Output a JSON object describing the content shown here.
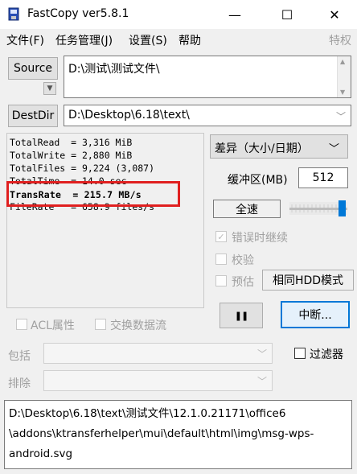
{
  "window": {
    "title": "FastCopy ver5.8.1",
    "controls": {
      "minimize": "—",
      "maximize": "☐",
      "close": "✕"
    }
  },
  "menu": {
    "items": [
      "文件(F)",
      "任务管理(J)",
      "设置(S)",
      "帮助"
    ],
    "right": "特权"
  },
  "source": {
    "button": "Source",
    "path": "D:\\测试\\测试文件\\"
  },
  "destdir": {
    "button": "DestDir",
    "path": "D:\\Desktop\\6.18\\text\\"
  },
  "stats": {
    "lines": [
      "TotalRead  = 3,316 MiB",
      "TotalWrite = 2,880 MiB",
      "TotalFiles = 9,224 (3,087)",
      "TotalTime  = 14.0 sec",
      "TransRate  = 215.7 MB/s",
      "FileRate   = 658.9 files/s"
    ]
  },
  "mode": {
    "selected": "差异（大小/日期）"
  },
  "buffer": {
    "label": "缓冲区(MB)",
    "value": "512"
  },
  "speed": {
    "button": "全速",
    "slider_level": 1.0
  },
  "options": {
    "continue_on_error": "错误时继续",
    "verify": "校验",
    "estimate": "预估",
    "hdd_mode": "相同HDD模式",
    "acl": "ACL属性",
    "alt_stream": "交换数据流",
    "filter": "过滤器"
  },
  "actions": {
    "pause_symbol": "❚❚",
    "abort": "中断..."
  },
  "filters": {
    "include_label": "包括",
    "exclude_label": "排除"
  },
  "status": {
    "text": "D:\\Desktop\\6.18\\text\\测试文件\\12.1.0.21171\\office6\n\\addons\\ktransferhelper\\mui\\default\\html\\img\\msg-wps-\nandroid.svg"
  },
  "colors": {
    "highlight": "#e02020",
    "accent": "#0078d7"
  },
  "icons": {
    "app": "fastcopy-app-icon",
    "dropdown": "chevron-down-icon"
  }
}
